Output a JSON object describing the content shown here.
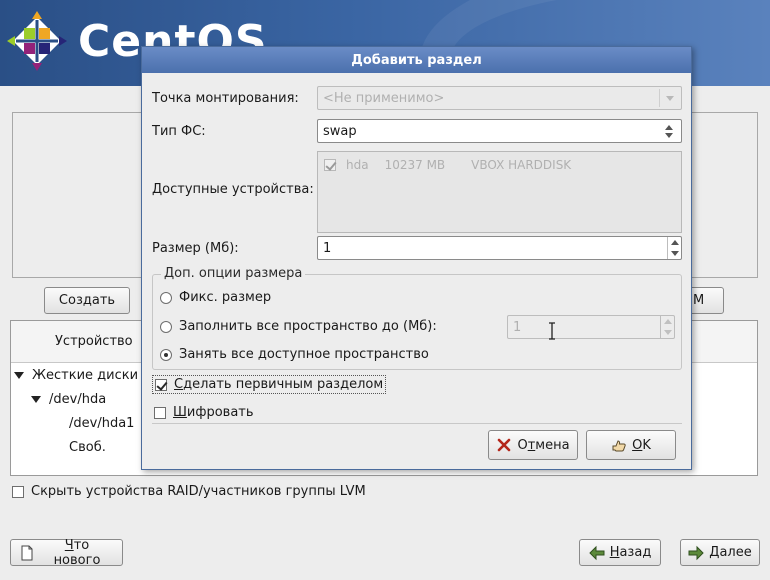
{
  "brand": {
    "name": "CentOS"
  },
  "background": {
    "create_button": "Создать",
    "tree": {
      "header_device": "Устройство",
      "rows": [
        {
          "label": "Жесткие диски",
          "expanded": true
        },
        {
          "label": "/dev/hda",
          "expanded": true
        },
        {
          "label": "/dev/hda1"
        },
        {
          "label": "Своб."
        }
      ]
    },
    "hide_raid": {
      "label": "Скрыть устройства RAID/участников группы LVM",
      "checked": false
    },
    "whats_new_button": {
      "prefix": "",
      "underline": "Ч",
      "rest": "то нового"
    },
    "back_button": {
      "prefix": "",
      "underline": "Н",
      "rest": "азад"
    },
    "next_button": {
      "prefix": "",
      "underline": "Д",
      "rest": "алее"
    }
  },
  "dialog": {
    "title": "Добавить раздел",
    "mount_point": {
      "label": "Точка монтирования:",
      "value": "<Не применимо>",
      "disabled": true
    },
    "fs_type": {
      "label": "Тип ФС:",
      "value": "swap"
    },
    "devices": {
      "label": "Доступные устройства:",
      "items": [
        {
          "name": "hda",
          "size": "10237 MB",
          "model": "VBOX HARDDISK",
          "checked": true
        }
      ]
    },
    "size": {
      "label": "Размер (Мб):",
      "value": "1"
    },
    "size_options": {
      "title": "Доп. опции размера",
      "fixed": {
        "label": "Фикс. размер",
        "checked": false
      },
      "fill_to": {
        "label": "Заполнить все пространство до (Мб):",
        "checked": false,
        "value": "1"
      },
      "fill_all": {
        "label": "Занять все доступное пространство",
        "checked": true
      }
    },
    "primary": {
      "prefix": "",
      "underline": "С",
      "rest": "делать первичным разделом",
      "checked": true
    },
    "encrypt": {
      "prefix": "",
      "underline": "Ш",
      "rest": "ифровать",
      "checked": false
    },
    "cancel_button": {
      "prefix": "О",
      "underline": "т",
      "rest": "мена"
    },
    "ok_button": {
      "prefix": "",
      "underline": "О",
      "rest": "K"
    }
  },
  "colors": {
    "title_bar": "#5578b5",
    "banner": "#2a4f86",
    "window_bg": "#ededed"
  }
}
